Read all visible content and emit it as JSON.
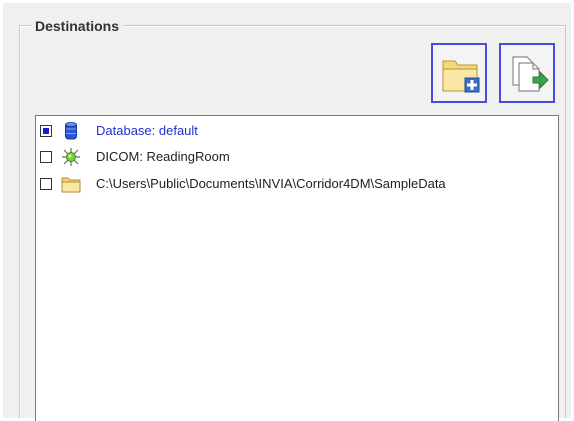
{
  "destinations": {
    "title": "Destinations",
    "buttons": [
      {
        "icon": "add-folder-icon"
      },
      {
        "icon": "copy-to-icon"
      }
    ],
    "items": [
      {
        "label": "Database: default",
        "checked": true,
        "icon": "database-icon"
      },
      {
        "label": "DICOM: ReadingRoom",
        "checked": false,
        "icon": "dicom-node-icon"
      },
      {
        "label": "C:\\Users\\Public\\Documents\\INVIA\\Corridor4DM\\SampleData",
        "checked": false,
        "icon": "folder-icon"
      }
    ]
  },
  "colors": {
    "panel_bg": "#f0f0f0",
    "button_border": "#4a4ae0",
    "selected_text": "#2233cc",
    "check_fill": "#1a1ad0"
  }
}
